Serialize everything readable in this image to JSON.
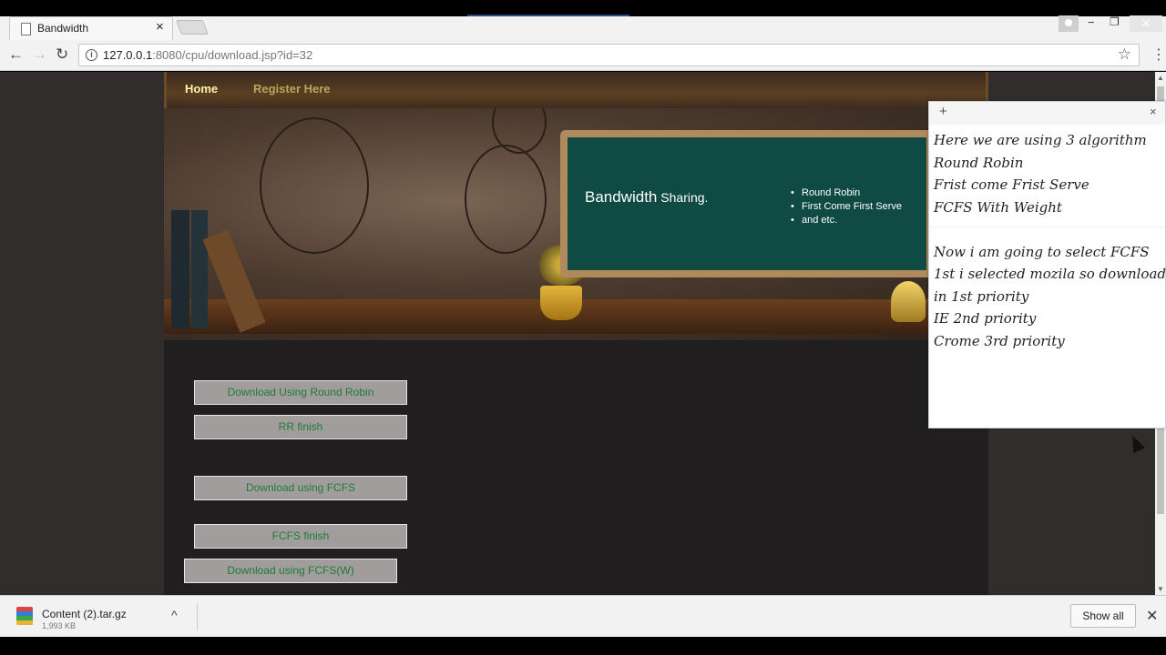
{
  "tab": {
    "title": "Bandwidth",
    "close": "×"
  },
  "window": {
    "minimize": "−",
    "maximize": "❐",
    "close": "✕"
  },
  "toolbar": {
    "back": "←",
    "forward": "→",
    "reload": "↻",
    "info": "i",
    "url_host": "127.0.0.1",
    "url_rest": ":8080/cpu/download.jsp?id=32",
    "star": "☆",
    "menu": "⋮"
  },
  "site_nav": {
    "home": "Home",
    "register": "Register Here"
  },
  "banner": {
    "title": "Bandwidth",
    "title_suffix": " Sharing.",
    "list": [
      "Round Robin",
      "First Come First Serve",
      "and etc."
    ]
  },
  "buttons": {
    "rr": "Download Using Round Robin",
    "rr_finish": "RR finish",
    "fcfs": "Download using FCFS",
    "fcfs_finish": "FCFS finish",
    "fcfs_w": "Download using FCFS(W)"
  },
  "sticky": {
    "add": "+",
    "close": "×",
    "lines": [
      "Here we are using 3 algorithm",
      "Round Robin",
      "Frist come Frist Serve",
      "FCFS With Weight",
      "Now i am going to select FCFS",
      "1st i selected mozila so download",
      "in 1st priority",
      "IE 2nd priority",
      "Crome 3rd priority"
    ]
  },
  "scroll": {
    "up": "▲",
    "down": "▼"
  },
  "downloads": {
    "file_name": "Content (2).tar.gz",
    "file_size": "1,993 KB",
    "caret": "^",
    "show_all": "Show all",
    "close": "✕"
  }
}
